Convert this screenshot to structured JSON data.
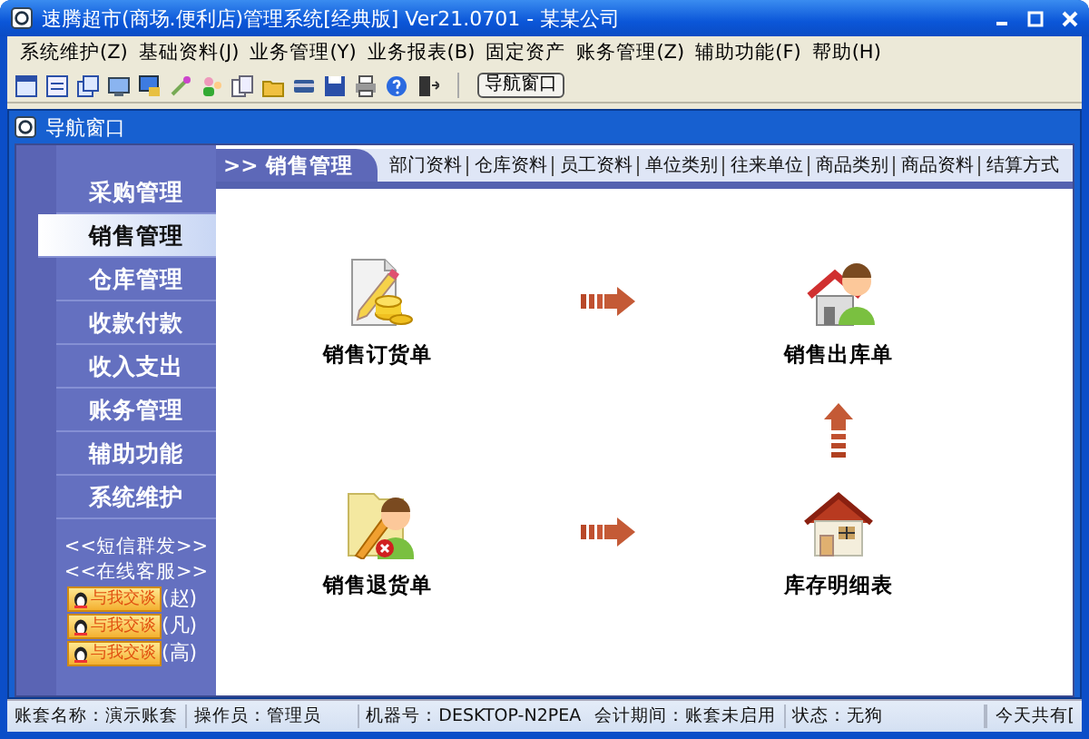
{
  "window": {
    "title": "速腾超市(商场.便利店)管理系统[经典版] Ver21.0701  -  某某公司"
  },
  "menu": [
    {
      "label": "系统维护(Z)"
    },
    {
      "label": "基础资料(J)"
    },
    {
      "label": "业务管理(Y)"
    },
    {
      "label": "业务报表(B)"
    },
    {
      "label": "固定资产"
    },
    {
      "label": "账务管理(Z)"
    },
    {
      "label": "辅助功能(F)"
    },
    {
      "label": "帮助(H)"
    }
  ],
  "toolbar": {
    "button": "导航窗口"
  },
  "nav_window": {
    "title": "导航窗口"
  },
  "sidebar": {
    "items": [
      {
        "label": "采购管理",
        "selected": false
      },
      {
        "label": "销售管理",
        "selected": true
      },
      {
        "label": "仓库管理",
        "selected": false
      },
      {
        "label": "收款付款",
        "selected": false
      },
      {
        "label": "收入支出",
        "selected": false
      },
      {
        "label": "账务管理",
        "selected": false
      },
      {
        "label": "辅助功能",
        "selected": false
      },
      {
        "label": "系统维护",
        "selected": false
      }
    ],
    "links": [
      "<<短信群发>>",
      "<<在线客服>>"
    ],
    "chat": [
      {
        "button": "与我交谈",
        "name": "(赵)"
      },
      {
        "button": "与我交谈",
        "name": "(凡)"
      },
      {
        "button": "与我交谈",
        "name": "(高)"
      }
    ]
  },
  "header": {
    "section": ">> 销售管理",
    "links": [
      "部门资料",
      "仓库资料",
      "员工资料",
      "单位类别",
      "往来单位",
      "商品类别",
      "商品资料",
      "结算方式"
    ]
  },
  "flow": [
    {
      "label": "销售订货单",
      "kind": "order"
    },
    {
      "label": "销售出库单",
      "kind": "outbound"
    },
    {
      "label": "销售退货单",
      "kind": "return"
    },
    {
      "label": "库存明细表",
      "kind": "inventory"
    }
  ],
  "status_bar": [
    "账套名称：演示账套",
    "操作员：管理员",
    "机器号：DESKTOP-N2PEA",
    "会计期间：账套未启用",
    "状态：无狗",
    "今天共有["
  ]
}
